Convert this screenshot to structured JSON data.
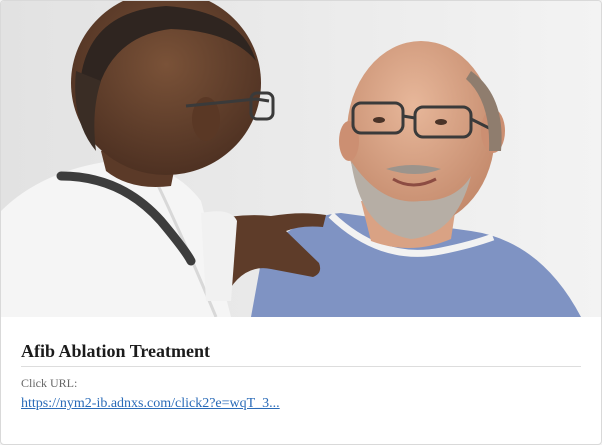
{
  "ad": {
    "image": {
      "description_icon": "doctor-patient-photo"
    },
    "headline": "Afib Ablation Treatment",
    "click_label": "Click URL:",
    "click_url": "https://nym2-ib.adnxs.com/click2?e=wqT_3..."
  },
  "colors": {
    "link": "#2a6bb8",
    "headline": "#1b1b1b",
    "label": "#666666",
    "divider": "#dddddd"
  }
}
